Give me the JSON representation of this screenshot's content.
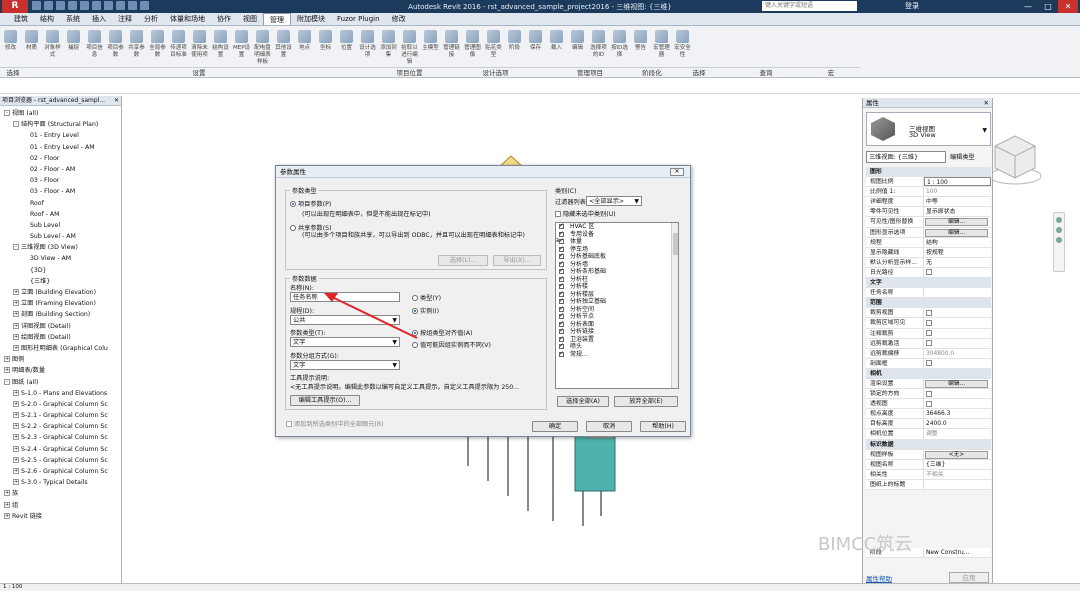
{
  "titlebar": {
    "title": "Autodesk Revit 2016  -  rst_advanced_sample_project2016 - 三维视图: {三维}",
    "search_placeholder": "键入关键字或短语",
    "login": "登录",
    "minimize": "—",
    "restore": "□",
    "close": "✕"
  },
  "menu": [
    "建筑",
    "结构",
    "系统",
    "插入",
    "注释",
    "分析",
    "体量和场地",
    "协作",
    "视图",
    "管理",
    "附加模块",
    "Fuzor Plugin",
    "修改"
  ],
  "ribbon": {
    "tools": [
      "修改",
      "材质",
      "对象样式",
      "捕捉",
      "项目信息",
      "项目参数",
      "共享参数",
      "全局参数",
      "传递项目标准",
      "清除未使用项",
      "结构设置",
      "MEP设置",
      "配电盘明细表样板",
      "其他设置",
      "地点",
      "坐标",
      "位置",
      "设计选项",
      "添加到集",
      "拾取以进行编辑",
      "主模型",
      "管理链接",
      "管理图像",
      "贴花类型",
      "阶段",
      "保存",
      "载入",
      "编辑",
      "选择项的ID",
      "按ID选择",
      "警告",
      "宏管理器",
      "宏安全性"
    ],
    "groups": [
      "选择",
      "设置",
      "项目位置",
      "设计选项",
      "管理项目",
      "阶段化",
      "选择",
      "查询",
      "宏"
    ]
  },
  "project_browser": {
    "title": "项目浏览器 - rst_advanced_sampl...",
    "close": "✕",
    "tree": [
      {
        "t": "视图 (all)",
        "lvl": 0,
        "tog": "-"
      },
      {
        "t": "结构平面 (Structural Plan)",
        "lvl": 1,
        "tog": "-"
      },
      {
        "t": "01 - Entry Level",
        "lvl": 2
      },
      {
        "t": "01 - Entry Level - AM",
        "lvl": 2
      },
      {
        "t": "02 - Floor",
        "lvl": 2
      },
      {
        "t": "02 - Floor - AM",
        "lvl": 2
      },
      {
        "t": "03 - Floor",
        "lvl": 2
      },
      {
        "t": "03 - Floor - AM",
        "lvl": 2
      },
      {
        "t": "Roof",
        "lvl": 2
      },
      {
        "t": "Roof - AM",
        "lvl": 2
      },
      {
        "t": "Sub Level",
        "lvl": 2
      },
      {
        "t": "Sub Level - AM",
        "lvl": 2
      },
      {
        "t": "三维视图 (3D View)",
        "lvl": 1,
        "tog": "-"
      },
      {
        "t": "3D View - AM",
        "lvl": 2
      },
      {
        "t": "{3D}",
        "lvl": 2
      },
      {
        "t": "{三维}",
        "lvl": 2
      },
      {
        "t": "立面 (Building Elevation)",
        "lvl": 1,
        "tog": "+"
      },
      {
        "t": "立面 (Framing Elevation)",
        "lvl": 1,
        "tog": "+"
      },
      {
        "t": "剖面 (Building Section)",
        "lvl": 1,
        "tog": "+"
      },
      {
        "t": "详图视图 (Detail)",
        "lvl": 1,
        "tog": "+"
      },
      {
        "t": "绘图视图 (Detail)",
        "lvl": 1,
        "tog": "+"
      },
      {
        "t": "图形柱明细表 (Graphical Colu",
        "lvl": 1,
        "tog": "+"
      },
      {
        "t": "图例",
        "lvl": 0,
        "tog": "+"
      },
      {
        "t": "明细表/数量",
        "lvl": 0,
        "tog": "+"
      },
      {
        "t": "图纸 (all)",
        "lvl": 0,
        "tog": "-"
      },
      {
        "t": "S-1.0 - Plans and Elevations",
        "lvl": 1,
        "tog": "+"
      },
      {
        "t": "S-2.0 - Graphical Column Sc",
        "lvl": 1,
        "tog": "+"
      },
      {
        "t": "S-2.1 - Graphical Column Sc",
        "lvl": 1,
        "tog": "+"
      },
      {
        "t": "S-2.2 - Graphical Column Sc",
        "lvl": 1,
        "tog": "+"
      },
      {
        "t": "S-2.3 - Graphical Column Sc",
        "lvl": 1,
        "tog": "+"
      },
      {
        "t": "S-2.4 - Graphical Column Sc",
        "lvl": 1,
        "tog": "+"
      },
      {
        "t": "S-2.5 - Graphical Column Sc",
        "lvl": 1,
        "tog": "+"
      },
      {
        "t": "S-2.6 - Graphical Column Sc",
        "lvl": 1,
        "tog": "+"
      },
      {
        "t": "S-3.0 - Typical Details",
        "lvl": 1,
        "tog": "+"
      },
      {
        "t": "族",
        "lvl": 0,
        "tog": "+"
      },
      {
        "t": "组",
        "lvl": 0,
        "tog": "+"
      },
      {
        "t": "Revit 链接",
        "lvl": 0,
        "tog": "+"
      }
    ]
  },
  "properties": {
    "title": "属性",
    "close": "✕",
    "type_line1": "三维视图",
    "type_line2": "3D View",
    "selector": "三维视图: {三维}",
    "edit_type": "编辑类型",
    "rows": [
      {
        "sec": "图形"
      },
      {
        "k": "视图比例",
        "v": "1 : 100",
        "input": true
      },
      {
        "k": "比例值 1:",
        "v": "100",
        "gray": true
      },
      {
        "k": "详细程度",
        "v": "中等"
      },
      {
        "k": "零件可见性",
        "v": "显示原状态"
      },
      {
        "k": "可见性/图形替换",
        "btn": "编辑..."
      },
      {
        "k": "图形显示选项",
        "btn": "编辑..."
      },
      {
        "k": "规程",
        "v": "结构"
      },
      {
        "k": "显示隐藏线",
        "v": "按规程"
      },
      {
        "k": "默认分析显示样...",
        "v": "无"
      },
      {
        "k": "日光路径",
        "cb": true
      },
      {
        "sec": "文字"
      },
      {
        "k": "任务名称",
        "v": ""
      },
      {
        "sec": "范围"
      },
      {
        "k": "裁剪视图",
        "cb": true
      },
      {
        "k": "裁剪区域可见",
        "cb": true
      },
      {
        "k": "注释裁剪",
        "cb": true,
        "gray": true
      },
      {
        "k": "远剪裁激活",
        "cb": true
      },
      {
        "k": "远剪裁偏移",
        "v": "304800.0",
        "gray": true
      },
      {
        "k": "剖面框",
        "cb": true
      },
      {
        "sec": "相机"
      },
      {
        "k": "渲染设置",
        "btn": "编辑..."
      },
      {
        "k": "锁定的方向",
        "cb": true,
        "gray": true
      },
      {
        "k": "透视图",
        "cb": true,
        "gray": true
      },
      {
        "k": "视点高度",
        "v": "36466.3"
      },
      {
        "k": "目标高度",
        "v": "2400.0"
      },
      {
        "k": "相机位置",
        "v": "调整",
        "gray": true
      },
      {
        "sec": "标识数据"
      },
      {
        "k": "视图样板",
        "btn": "<无>"
      },
      {
        "k": "视图名称",
        "v": "{三维}"
      },
      {
        "k": "相关性",
        "v": "不相关",
        "gray": true
      },
      {
        "k": "图纸上的标题",
        "v": ""
      }
    ],
    "phase_label": "阶段",
    "phase_value": "New Constru...",
    "help_link": "属性帮助",
    "apply": "应用"
  },
  "dialog": {
    "title": "参数属性",
    "close": "✕",
    "param_type_label": "参数类型",
    "project_param": "项目参数(P)",
    "project_param_desc": "(可以出现在明细表中，但是不能出现在标记中)",
    "shared_param": "共享参数(S)",
    "shared_param_desc": "(可以由多个项目和族共享，可以导出到 ODBC，并且可以出现在明细表和标记中)",
    "select_btn": "选择(L)...",
    "export_btn": "导出(X)...",
    "param_data_label": "参数数据",
    "name_label": "名称(N):",
    "name_value": "任务名称",
    "discipline_label": "规程(D):",
    "discipline_value": "公共",
    "ptype_label": "参数类型(T):",
    "ptype_value": "文字",
    "group_label": "参数分组方式(G):",
    "group_value": "文字",
    "type_radio": "类型(Y)",
    "instance_radio": "实例(I)",
    "align_radio": "按组类型对齐值(A)",
    "vary_radio": "值可能因组实例而不同(V)",
    "tooltip_label": "工具提示说明:",
    "tooltip_value": "<无工具提示说明。编辑此参数以编写自定义工具提示。自定义工具提示限为 250...",
    "edit_tooltip_btn": "编辑工具提示(O)...",
    "add_all_checkbox": "添加到所选类别中的全部图元(R)",
    "categories_label": "类别(C)",
    "filter_label": "过滤器列表(F):",
    "filter_value": "<全部显示>",
    "hide_unchecked": "隐藏未选中类别(U)",
    "categories": [
      "HVAC 区",
      "专用设备",
      "体量",
      "停车场",
      "分析基础底板",
      "分析墙",
      "分析条形基础",
      "分析柱",
      "分析楼",
      "分析楼层",
      "分析独立基础",
      "分析空间",
      "分析节点",
      "分析表面",
      "分析链接",
      "卫浴装置",
      "喷头",
      "常规..."
    ],
    "select_all": "选择全部(A)",
    "deselect_all": "放弃全部(E)",
    "ok": "确定",
    "cancel": "取消",
    "help": "帮助(H)"
  },
  "status": {
    "scale": "1 : 100"
  },
  "watermark": "BIMCC筑云"
}
